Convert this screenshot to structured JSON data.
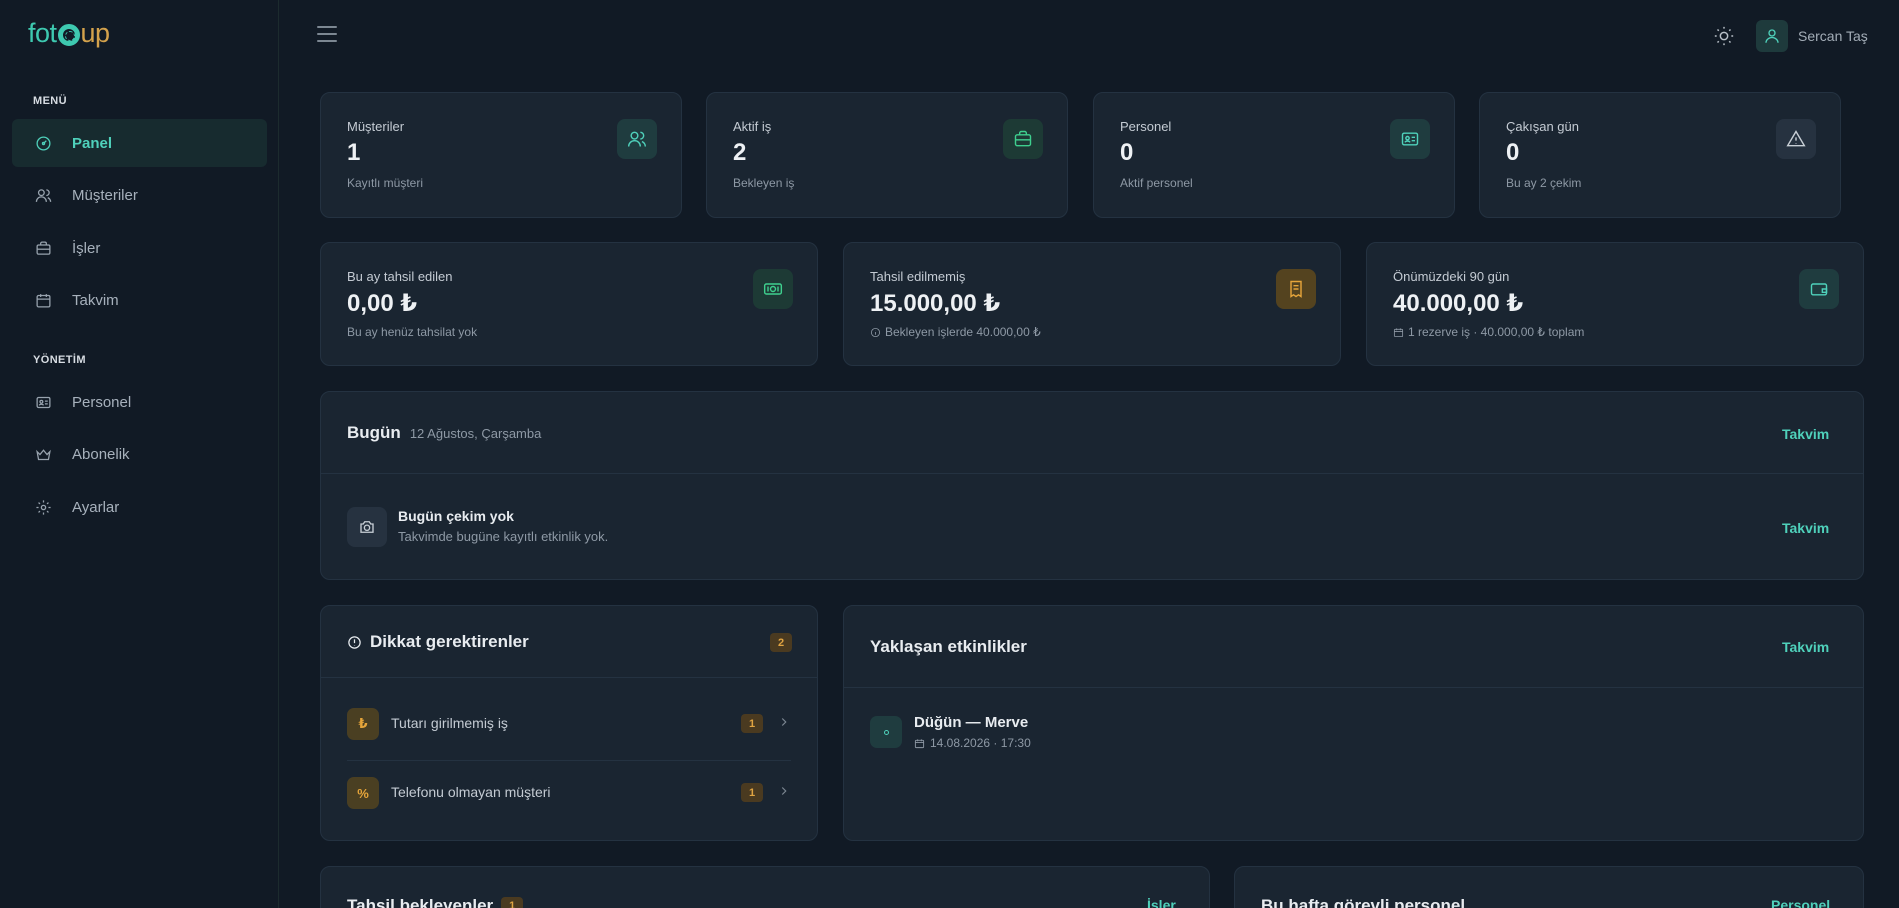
{
  "brand": {
    "part1": "fot",
    "part2": "up"
  },
  "sidebar": {
    "section_menu": "MENÜ",
    "section_admin": "YÖNETİM",
    "menu_items": [
      {
        "label": "Panel",
        "icon": "gauge-icon",
        "active": true
      },
      {
        "label": "Müşteriler",
        "icon": "users-icon"
      },
      {
        "label": "İşler",
        "icon": "briefcase-icon"
      },
      {
        "label": "Takvim",
        "icon": "calendar-icon"
      }
    ],
    "admin_items": [
      {
        "label": "Personel",
        "icon": "id-card-icon"
      },
      {
        "label": "Abonelik",
        "icon": "crown-icon"
      },
      {
        "label": "Ayarlar",
        "icon": "gear-icon"
      }
    ]
  },
  "header": {
    "user_name": "Sercan Taş"
  },
  "stats_row1": [
    {
      "label": "Müşteriler",
      "value": "1",
      "sub": "Kayıtlı müşteri",
      "icon": "users-icon"
    },
    {
      "label": "Aktif iş",
      "value": "2",
      "sub": "Bekleyen iş",
      "icon": "briefcase-icon"
    },
    {
      "label": "Personel",
      "value": "0",
      "sub": "Aktif personel",
      "icon": "id-card-icon"
    },
    {
      "label": "Çakışan gün",
      "value": "0",
      "sub": "Bu ay 2 çekim",
      "icon": "warning-icon"
    }
  ],
  "stats_row2": [
    {
      "label": "Bu ay tahsil edilen",
      "value": "0,00 ₺",
      "sub": "Bu ay henüz tahsilat yok",
      "icon": "cash-icon"
    },
    {
      "label": "Tahsil edilmemiş",
      "value": "15.000,00 ₺",
      "sub": "Bekleyen işlerde 40.000,00 ₺",
      "icon": "receipt-icon"
    },
    {
      "label": "Önümüzdeki 90 gün",
      "value": "40.000,00 ₺",
      "sub": "1 rezerve iş · 40.000,00 ₺ toplam",
      "icon": "wallet-icon"
    }
  ],
  "today": {
    "title": "Bugün",
    "date": "12 Ağustos, Çarşamba",
    "link": "Takvim",
    "empty_title": "Bugün çekim yok",
    "empty_sub": "Takvimde bugüne kayıtlı etkinlik yok.",
    "empty_link": "Takvim"
  },
  "attention": {
    "title": "Dikkat gerektirenler",
    "count": "2",
    "items": [
      {
        "label": "Tutarı girilmemiş iş",
        "count": "1",
        "glyph": "₺"
      },
      {
        "label": "Telefonu olmayan müşteri",
        "count": "1",
        "glyph": "%"
      }
    ]
  },
  "upcoming": {
    "title": "Yaklaşan etkinlikler",
    "link": "Takvim",
    "events": [
      {
        "title": "Düğün — Merve",
        "datetime": "14.08.2026 · 17:30"
      }
    ]
  },
  "bottom": {
    "left_title": "Tahsil bekleyenler",
    "left_count": "1",
    "left_link": "İşler",
    "right_title": "Bu hafta görevli personel",
    "right_link": "Personel"
  }
}
